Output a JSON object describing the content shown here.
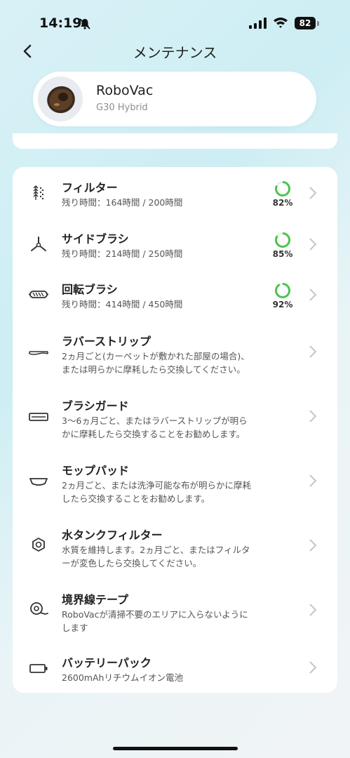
{
  "status": {
    "time": "14:19",
    "battery": "82"
  },
  "nav": {
    "title": "メンテナンス"
  },
  "device": {
    "name": "RoboVac",
    "model": "G30 Hybrid"
  },
  "items": [
    {
      "title": "フィルター",
      "desc": "残り時間：164時間 / 200時間",
      "percent_label": "82%",
      "percent": 82,
      "icon": "filter-icon"
    },
    {
      "title": "サイドブラシ",
      "desc": "残り時間：214時間 / 250時間",
      "percent_label": "85%",
      "percent": 85,
      "icon": "side-brush-icon"
    },
    {
      "title": "回転ブラシ",
      "desc": "残り時間：414時間 / 450時間",
      "percent_label": "92%",
      "percent": 92,
      "icon": "rolling-brush-icon"
    },
    {
      "title": "ラバーストリップ",
      "desc1": "2ヵ月ごと(カーペットが敷かれた部屋の場合)、",
      "desc2": "または明らかに摩耗したら交換してください。",
      "icon": "rubber-strip-icon"
    },
    {
      "title": "ブラシガード",
      "desc1": "3〜6ヵ月ごと、またはラバーストリップが明ら",
      "desc2": "かに摩耗したら交換することをお勧めします。",
      "icon": "brush-guard-icon"
    },
    {
      "title": "モップパッド",
      "desc1": "2ヵ月ごと、または洗浄可能な布が明らかに摩耗",
      "desc2": "したら交換することをお勧めします。",
      "icon": "mop-pad-icon"
    },
    {
      "title": "水タンクフィルター",
      "desc1": "水質を維持します。2ヵ月ごと、またはフィルタ",
      "desc2": "ーが変色したら交換してください。",
      "icon": "water-tank-filter-icon"
    },
    {
      "title": "境界線テープ",
      "desc1": "RoboVacが清掃不要のエリアに入らないように",
      "desc2": "します",
      "icon": "boundary-tape-icon"
    },
    {
      "title": "バッテリーパック",
      "desc": "2600mAhリチウムイオン電池",
      "icon": "battery-pack-icon"
    }
  ],
  "colors": {
    "progress": "#4cc44f",
    "progress_track": "#e6f4e6",
    "chevron": "#c4c6c9"
  }
}
